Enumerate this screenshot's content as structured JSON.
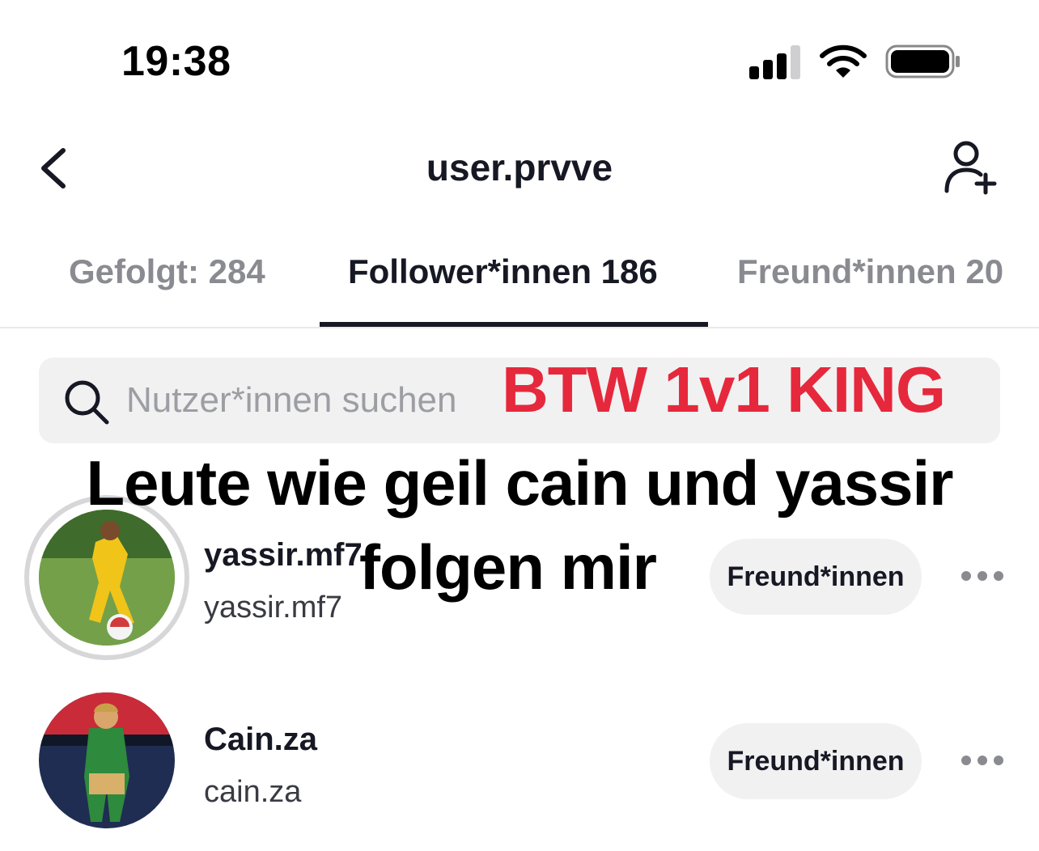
{
  "status_bar": {
    "time": "19:38"
  },
  "header": {
    "title": "user.prvve"
  },
  "tabs": [
    {
      "label": "Gefolgt: 284",
      "active": false
    },
    {
      "label": "Follower*innen 186",
      "active": true
    },
    {
      "label": "Freund*innen 20",
      "active": false
    }
  ],
  "search": {
    "placeholder": "Nutzer*innen suchen"
  },
  "overlay": {
    "red_text": "BTW 1v1 KING",
    "black_line1": "Leute wie geil cain und yassir",
    "black_line2": "folgen mir"
  },
  "users": [
    {
      "name": "yassir.mf7",
      "handle": "yassir.mf7",
      "button": "Freund*innen"
    },
    {
      "name": "Cain.za",
      "handle": "cain.za",
      "button": "Freund*innen"
    }
  ],
  "colors": {
    "accent_red": "#e6283c",
    "text": "#161823",
    "muted": "#8a8b91"
  }
}
